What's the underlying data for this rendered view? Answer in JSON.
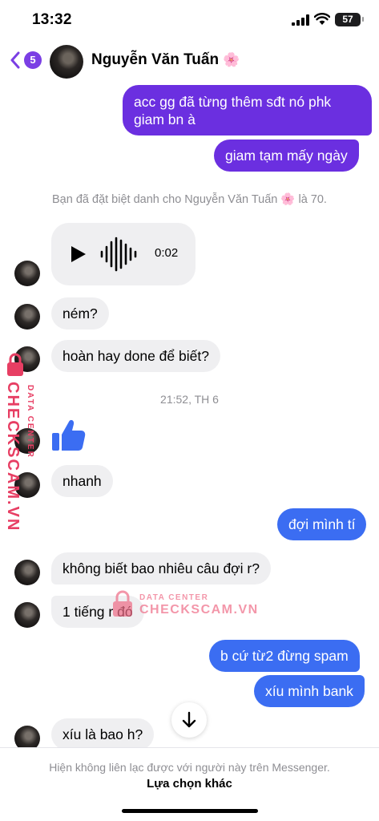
{
  "status_bar": {
    "time": "13:32",
    "battery": "57"
  },
  "header": {
    "back_badge": "5",
    "contact_name": "Nguyễn Văn Tuấn",
    "contact_emoji": "🌸"
  },
  "messages": {
    "m1": "acc gg đã từng thêm sđt nó phk",
    "m1b": "giam bn à",
    "m2": "giam tạm mấy ngày",
    "nickname_note": "Bạn đã đặt biệt danh cho Nguyễn Văn Tuấn 🌸 là 70.",
    "voice_duration": "0:02",
    "m3": "ném?",
    "m4": "hoàn hay done để biết?",
    "timestamp": "21:52, TH 6",
    "m5": "nhanh",
    "m6": "đợi mình tí",
    "m7": "không biết bao nhiêu câu đợi r?",
    "m8": "1 tiếng r đó",
    "m9": "b cứ từ2 đừng spam",
    "m10": "xíu mình bank",
    "m11": "xíu là bao h?"
  },
  "footer": {
    "notice": "Hiện không liên lạc được với người này trên Messenger.",
    "action": "Lựa chọn khác"
  },
  "watermark": {
    "brand": "CHECKSCAM.VN",
    "tag": "DATA CENTER"
  },
  "colors": {
    "outgoing_purple": "#6b2fe0",
    "outgoing_blue": "#3b6df2",
    "incoming": "#efeff1",
    "accent": "#7b3fe4",
    "watermark": "#e73e63"
  },
  "icons": [
    "back-chevron-icon",
    "play-icon",
    "waveform-icon",
    "thumbs-up-icon",
    "arrow-down-icon",
    "lock-icon"
  ]
}
